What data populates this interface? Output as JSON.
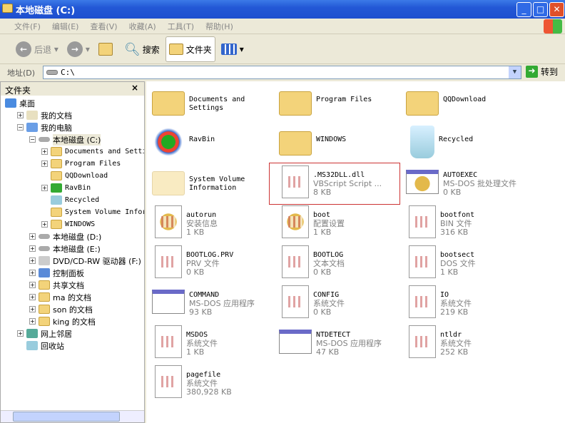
{
  "window": {
    "title": "本地磁盘 (C:)"
  },
  "menu": [
    "文件(F)",
    "编辑(E)",
    "查看(V)",
    "收藏(A)",
    "工具(T)",
    "帮助(H)"
  ],
  "toolbar": {
    "back": "后退",
    "search": "搜索",
    "folders": "文件夹"
  },
  "address": {
    "label": "地址(D)",
    "value": "C:\\",
    "go": "转到"
  },
  "folders_pane": {
    "title": "文件夹",
    "close": "×",
    "tree": [
      {
        "label": "桌面",
        "level": 0,
        "pm": "",
        "icon": "desktop"
      },
      {
        "label": "我的文档",
        "level": 1,
        "pm": "+",
        "icon": "docs"
      },
      {
        "label": "我的电脑",
        "level": 1,
        "pm": "-",
        "icon": "computer"
      },
      {
        "label": "本地磁盘 (C:)",
        "level": 2,
        "pm": "-",
        "icon": "drive",
        "selected": true
      },
      {
        "label": "Documents and Settin",
        "level": 3,
        "pm": "+",
        "icon": "folder",
        "mono": true
      },
      {
        "label": "Program Files",
        "level": 3,
        "pm": "+",
        "icon": "folder",
        "mono": true
      },
      {
        "label": "QQDownload",
        "level": 3,
        "pm": "",
        "icon": "folder",
        "mono": true
      },
      {
        "label": "RavBin",
        "level": 3,
        "pm": "+",
        "icon": "rav",
        "mono": true
      },
      {
        "label": "Recycled",
        "level": 3,
        "pm": "",
        "icon": "bin",
        "mono": true
      },
      {
        "label": "System Volume Inform",
        "level": 3,
        "pm": "",
        "icon": "folder",
        "mono": true
      },
      {
        "label": "WINDOWS",
        "level": 3,
        "pm": "+",
        "icon": "folder",
        "mono": true
      },
      {
        "label": "本地磁盘 (D:)",
        "level": 2,
        "pm": "+",
        "icon": "drive"
      },
      {
        "label": "本地磁盘 (E:)",
        "level": 2,
        "pm": "+",
        "icon": "drive"
      },
      {
        "label": "DVD/CD-RW 驱动器 (F:)",
        "level": 2,
        "pm": "+",
        "icon": "cd"
      },
      {
        "label": "控制面板",
        "level": 2,
        "pm": "+",
        "icon": "control"
      },
      {
        "label": "共享文档",
        "level": 2,
        "pm": "+",
        "icon": "folder"
      },
      {
        "label": "ma 的文档",
        "level": 2,
        "pm": "+",
        "icon": "folder"
      },
      {
        "label": "son 的文档",
        "level": 2,
        "pm": "+",
        "icon": "folder"
      },
      {
        "label": "king 的文档",
        "level": 2,
        "pm": "+",
        "icon": "folder"
      },
      {
        "label": "网上邻居",
        "level": 1,
        "pm": "+",
        "icon": "network"
      },
      {
        "label": "回收站",
        "level": 1,
        "pm": "",
        "icon": "bin"
      }
    ]
  },
  "files": [
    {
      "name": "Documents and Settings",
      "type": "",
      "size": "",
      "icon": "folder"
    },
    {
      "name": "Program Files",
      "type": "",
      "size": "",
      "icon": "folder"
    },
    {
      "name": "QQDownload",
      "type": "",
      "size": "",
      "icon": "folder"
    },
    {
      "name": "RavBin",
      "type": "",
      "size": "",
      "icon": "rav"
    },
    {
      "name": "WINDOWS",
      "type": "",
      "size": "",
      "icon": "folder"
    },
    {
      "name": "Recycled",
      "type": "",
      "size": "",
      "icon": "bin"
    },
    {
      "name": "System Volume Information",
      "type": "",
      "size": "",
      "icon": "folder faded"
    },
    {
      "name": ".MS32DLL.dll",
      "type": "VBScript Script ...",
      "size": "8 KB",
      "icon": "doc",
      "selected": true
    },
    {
      "name": "AUTOEXEC",
      "type": "MS-DOS 批处理文件",
      "size": "0 KB",
      "icon": "win gear"
    },
    {
      "name": "autorun",
      "type": "安装信息",
      "size": "1 KB",
      "icon": "doc gear"
    },
    {
      "name": "boot",
      "type": "配置设置",
      "size": "1 KB",
      "icon": "doc gear"
    },
    {
      "name": "bootfont",
      "type": "BIN 文件",
      "size": "316 KB",
      "icon": "doc"
    },
    {
      "name": "BOOTLOG.PRV",
      "type": "PRV 文件",
      "size": "0 KB",
      "icon": "doc"
    },
    {
      "name": "BOOTLOG",
      "type": "文本文档",
      "size": "0 KB",
      "icon": "doc"
    },
    {
      "name": "bootsect",
      "type": "DOS 文件",
      "size": "1 KB",
      "icon": "doc"
    },
    {
      "name": "COMMAND",
      "type": "MS-DOS 应用程序",
      "size": "93 KB",
      "icon": "win"
    },
    {
      "name": "CONFIG",
      "type": "系统文件",
      "size": "0 KB",
      "icon": "doc"
    },
    {
      "name": "IO",
      "type": "系统文件",
      "size": "219 KB",
      "icon": "doc"
    },
    {
      "name": "MSDOS",
      "type": "系统文件",
      "size": "1 KB",
      "icon": "doc"
    },
    {
      "name": "NTDETECT",
      "type": "MS-DOS 应用程序",
      "size": "47 KB",
      "icon": "win"
    },
    {
      "name": "ntldr",
      "type": "系统文件",
      "size": "252 KB",
      "icon": "doc"
    },
    {
      "name": "pagefile",
      "type": "系统文件",
      "size": "380,928 KB",
      "icon": "doc"
    }
  ]
}
